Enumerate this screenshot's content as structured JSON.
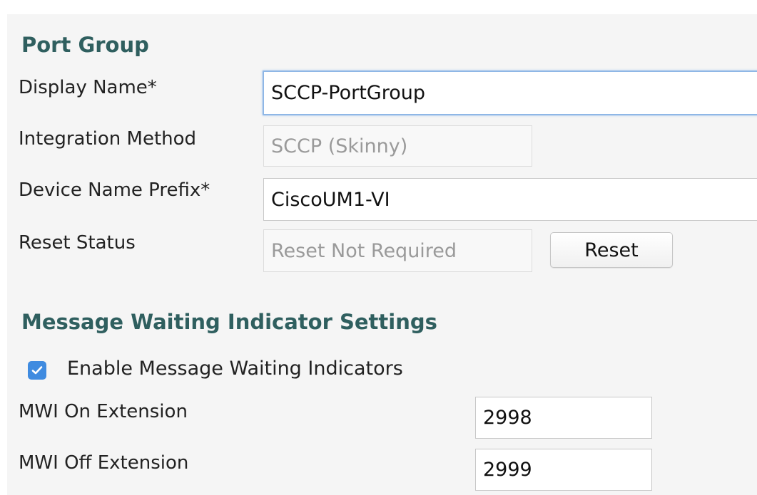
{
  "port_group": {
    "title": "Port Group",
    "display_name_label": "Display Name*",
    "display_name_value": "SCCP-PortGroup",
    "integration_method_label": "Integration Method",
    "integration_method_value": "SCCP (Skinny)",
    "device_name_prefix_label": "Device Name Prefix*",
    "device_name_prefix_value": "CiscoUM1-VI",
    "reset_status_label": "Reset Status",
    "reset_status_value": "Reset Not Required",
    "reset_button_label": "Reset"
  },
  "mwi": {
    "title": "Message Waiting Indicator Settings",
    "enable_label": "Enable Message Waiting Indicators",
    "enable_checked": true,
    "on_extension_label": "MWI On Extension",
    "on_extension_value": "2998",
    "off_extension_label": "MWI Off Extension",
    "off_extension_value": "2999"
  },
  "colors": {
    "section_title": "#2f5f5f",
    "checkbox_accent": "#3f8be0",
    "focus_border": "#8fb7e6"
  }
}
